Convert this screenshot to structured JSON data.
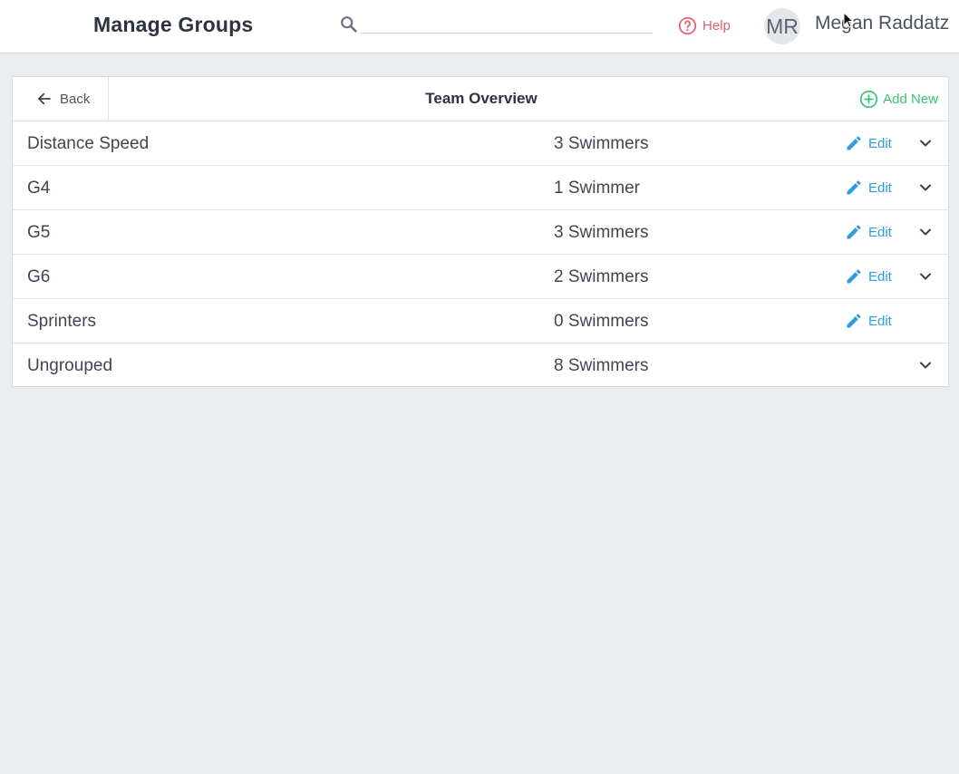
{
  "header": {
    "title": "Manage Groups",
    "search": {
      "value": "",
      "placeholder": ""
    },
    "help_label": "Help",
    "user": {
      "initials": "MR",
      "name": "Megan Raddatz"
    }
  },
  "panel": {
    "back_label": "Back",
    "title": "Team Overview",
    "add_new_label": "Add New"
  },
  "groups": [
    {
      "name": "Distance Speed",
      "count": "3 Swimmers",
      "edit_label": "Edit",
      "editable": true,
      "expandable": true
    },
    {
      "name": "G4",
      "count": "1 Swimmer",
      "edit_label": "Edit",
      "editable": true,
      "expandable": true
    },
    {
      "name": "G5",
      "count": "3 Swimmers",
      "edit_label": "Edit",
      "editable": true,
      "expandable": true
    },
    {
      "name": "G6",
      "count": "2 Swimmers",
      "edit_label": "Edit",
      "editable": true,
      "expandable": true
    },
    {
      "name": "Sprinters",
      "count": "0 Swimmers",
      "edit_label": "Edit",
      "editable": true,
      "expandable": false
    },
    {
      "name": "Ungrouped",
      "count": "8 Swimmers",
      "edit_label": "",
      "editable": false,
      "expandable": true
    }
  ],
  "icons": {
    "search": "search-icon",
    "help": "question-circle-icon",
    "back": "arrow-left-icon",
    "add": "plus-circle-icon",
    "edit": "pencil-icon",
    "expand": "chevron-down-icon"
  },
  "colors": {
    "help": "#e0606b",
    "add": "#3cc27a",
    "edit": "#2f9be0",
    "background": "#eaedf0"
  }
}
